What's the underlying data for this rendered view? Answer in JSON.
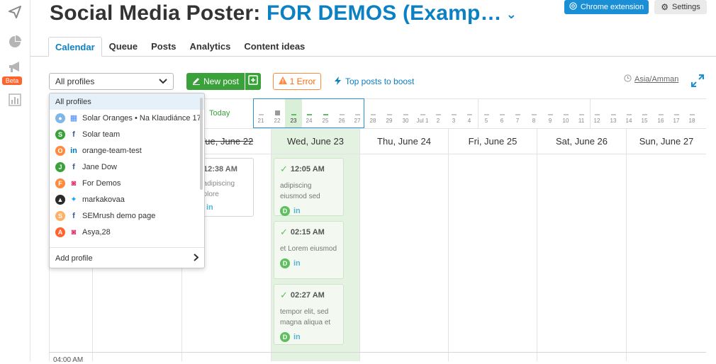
{
  "header": {
    "title_main": "Social Media Poster:",
    "title_project": "FOR DEMOS (Examp…",
    "chevron": "⌄",
    "chrome_label": "Chrome extension",
    "settings_label": "Settings"
  },
  "rail": {
    "beta": "Beta"
  },
  "tabs": [
    {
      "label": "Calendar"
    },
    {
      "label": "Queue"
    },
    {
      "label": "Posts"
    },
    {
      "label": "Analytics"
    },
    {
      "label": "Content ideas"
    }
  ],
  "toolbar": {
    "profile_value": "All profiles",
    "new_post": "New post",
    "error": "1 Error",
    "boost": "Top posts to boost",
    "timezone": "Asia/Amman"
  },
  "timeline": {
    "today": "Today",
    "days": [
      "21",
      "22",
      "23",
      "24",
      "25",
      "26",
      "27",
      "28",
      "29",
      "30",
      "Jul 1",
      "2",
      "3",
      "4",
      "5",
      "6",
      "7",
      "8",
      "9",
      "10",
      "11",
      "12",
      "13",
      "14",
      "15",
      "16",
      "17",
      "18"
    ]
  },
  "columns": [
    "Tue, June 22",
    "Wed, June 23",
    "Thu, June 24",
    "Fri, June 25",
    "Sat, June 26",
    "Sun, June 27"
  ],
  "time_label": "04:00 AM",
  "partial_card": {
    "time": "12:38 AM",
    "text": "t adipiscing dolore",
    "net": "in"
  },
  "cards": [
    {
      "time": "12:05 AM",
      "text": "adipiscing eiusmod sed",
      "badge": "D",
      "net": "in"
    },
    {
      "time": "02:15 AM",
      "text": "et Lorem eiusmod",
      "badge": "D",
      "net": "in"
    },
    {
      "time": "02:27 AM",
      "text": "tempor elit, sed magna aliqua et",
      "badge": "D",
      "net": "in"
    }
  ],
  "dropdown": {
    "items": [
      {
        "label": "All profiles"
      },
      {
        "label": "Solar Oranges • Na Klaudiánce 17"
      },
      {
        "label": "Solar team",
        "avatar": "S"
      },
      {
        "label": "orange-team-test",
        "avatar": "O"
      },
      {
        "label": "Jane Dow",
        "avatar": "J"
      },
      {
        "label": "For Demos",
        "avatar": "F"
      },
      {
        "label": "markakovaa"
      },
      {
        "label": "SEMrush demo page",
        "avatar": "S"
      },
      {
        "label": "Asya,28",
        "avatar": "A"
      }
    ],
    "footer": "Add profile"
  },
  "colors": {
    "accent": "#0b80c3",
    "green": "#3ba13b",
    "orange": "#ff6a00"
  }
}
